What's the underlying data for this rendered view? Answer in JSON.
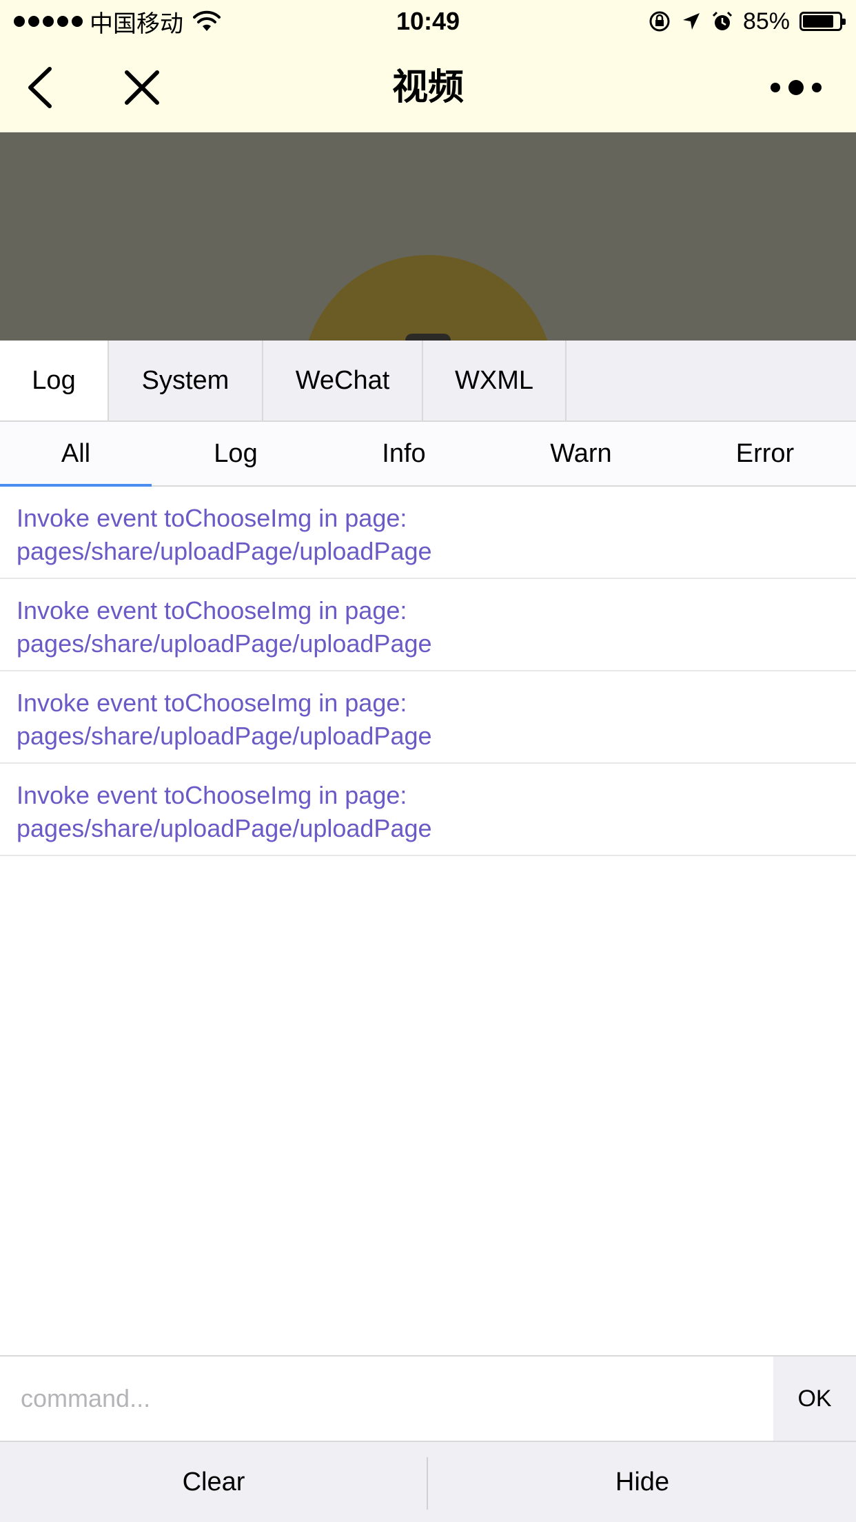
{
  "status_bar": {
    "carrier": "中国移动",
    "time": "10:49",
    "battery_percent": "85%",
    "battery_level": 0.85,
    "icons": [
      "signal-dots-icon",
      "wifi-icon",
      "orientation-lock-icon",
      "location-icon",
      "alarm-icon",
      "battery-icon"
    ]
  },
  "nav": {
    "title": "视频",
    "icons": [
      "back-arrow-icon",
      "close-icon",
      "more-dots-icon"
    ]
  },
  "main_tabs": [
    {
      "label": "Log",
      "active": true
    },
    {
      "label": "System",
      "active": false
    },
    {
      "label": "WeChat",
      "active": false
    },
    {
      "label": "WXML",
      "active": false
    }
  ],
  "filter_tabs": [
    {
      "label": "All",
      "active": true
    },
    {
      "label": "Log",
      "active": false
    },
    {
      "label": "Info",
      "active": false
    },
    {
      "label": "Warn",
      "active": false
    },
    {
      "label": "Error",
      "active": false
    }
  ],
  "logs": [
    {
      "line1": "Invoke event toChooseImg in page:",
      "line2": "pages/share/uploadPage/uploadPage"
    },
    {
      "line1": "Invoke event toChooseImg in page:",
      "line2": "pages/share/uploadPage/uploadPage"
    },
    {
      "line1": "Invoke event toChooseImg in page:",
      "line2": "pages/share/uploadPage/uploadPage"
    },
    {
      "line1": "Invoke event toChooseImg in page:",
      "line2": "pages/share/uploadPage/uploadPage"
    }
  ],
  "command": {
    "placeholder": "command...",
    "value": "",
    "ok_label": "OK"
  },
  "bottom": {
    "clear_label": "Clear",
    "hide_label": "Hide"
  },
  "colors": {
    "status_nav_bg": "#fffde6",
    "log_text": "#6a5ac6",
    "active_underline": "#4a8cf0",
    "panel_bg": "#efeff4"
  }
}
